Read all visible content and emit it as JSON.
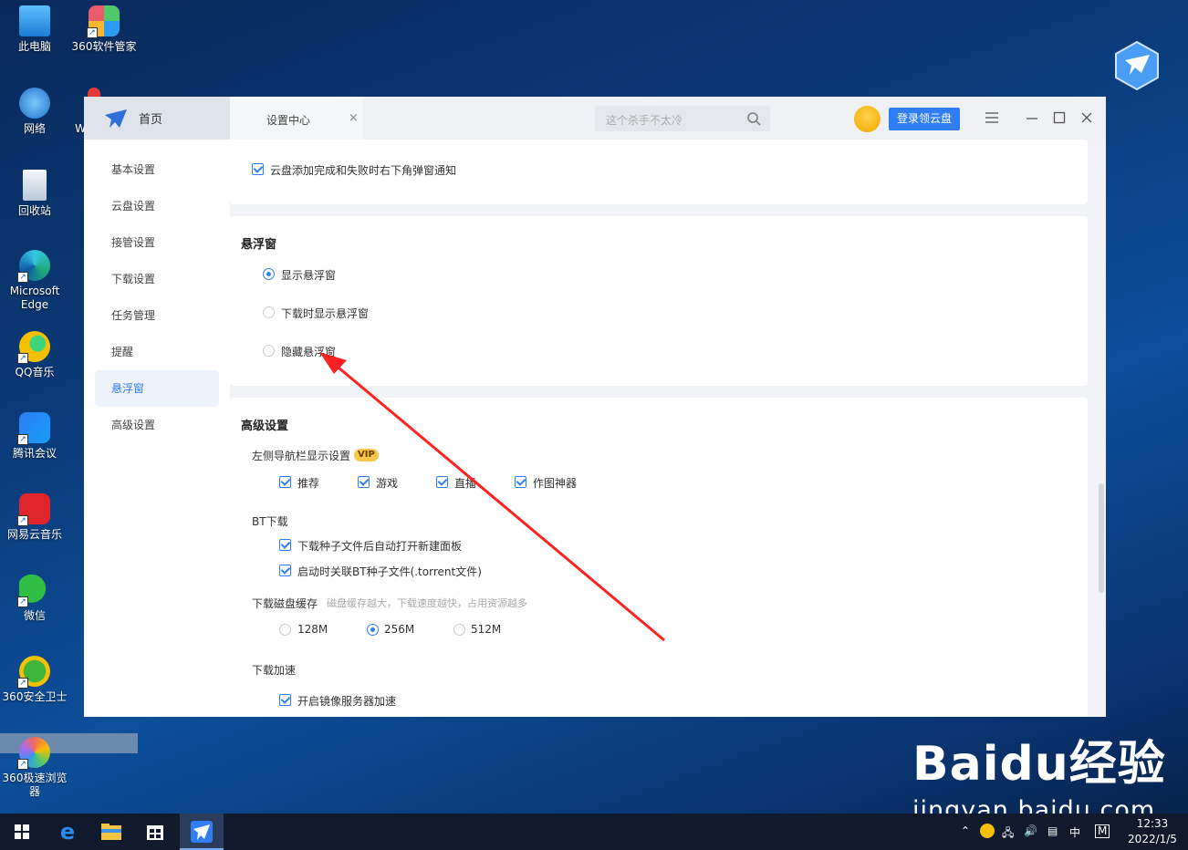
{
  "desktop": {
    "icons": [
      {
        "label": "此电脑",
        "icon": "computer-icon",
        "color": "#3aa0e8"
      },
      {
        "label": "360软件管家",
        "icon": "360-software-icon",
        "color": "#4fc96a"
      },
      {
        "label": "网络",
        "icon": "network-icon",
        "color": "#3a8fd8"
      },
      {
        "label": "回收站",
        "icon": "recycle-bin-icon",
        "color": "#d7e4ef"
      },
      {
        "label": "Microsoft Edge",
        "icon": "edge-icon",
        "color": "#1fa87a"
      },
      {
        "label": "QQ音乐",
        "icon": "qq-music-icon",
        "color": "#f5c000"
      },
      {
        "label": "腾讯会议",
        "icon": "tencent-meeting-icon",
        "color": "#2e7cf6"
      },
      {
        "label": "网易云音乐",
        "icon": "netease-music-icon",
        "color": "#e0242b"
      },
      {
        "label": "微信",
        "icon": "wechat-icon",
        "color": "#2fbf45"
      },
      {
        "label": "360安全卫士",
        "icon": "360-security-icon",
        "color": "#3fb63a"
      },
      {
        "label": "360极速浏览器",
        "icon": "360-browser-icon",
        "color": "#f36b5a"
      }
    ],
    "partial_label": "W"
  },
  "window": {
    "home_tab": "首页",
    "settings_tab": "设置中心",
    "search_placeholder": "这个杀手不太冷",
    "login_button": "登录领云盘",
    "accent": "#2f7ef5"
  },
  "sidebar": {
    "items": [
      "基本设置",
      "云盘设置",
      "接管设置",
      "下载设置",
      "任务管理",
      "提醒",
      "悬浮窗",
      "高级设置"
    ],
    "active": "悬浮窗"
  },
  "content": {
    "cloud_notify": "云盘添加完成和失败时右下角弹窗通知",
    "float": {
      "title": "悬浮窗",
      "options": [
        "显示悬浮窗",
        "下载时显示悬浮窗",
        "隐藏悬浮窗"
      ],
      "selected": "显示悬浮窗"
    },
    "advanced": {
      "title": "高级设置",
      "nav_label": "左侧导航栏显示设置",
      "vip": "VIP",
      "nav_items": [
        "推荐",
        "游戏",
        "直播",
        "作图神器"
      ],
      "bt_label": "BT下载",
      "bt_options": [
        "下载种子文件后自动打开新建面板",
        "启动时关联BT种子文件(.torrent文件)"
      ],
      "cache_label": "下载磁盘缓存",
      "cache_hint": "磁盘缓存越大，下载速度越快，占用资源越多",
      "cache_options": [
        "128M",
        "256M",
        "512M"
      ],
      "cache_selected": "256M",
      "accel_label": "下载加速",
      "accel_option": "开启镜像服务器加速"
    }
  },
  "watermark": {
    "big": "Baidu经验",
    "small": "jingyan.baidu.com"
  },
  "taskbar": {
    "tray_ime": "中",
    "tray_m": "M",
    "time": "12:33",
    "date": "2022/1/5"
  }
}
